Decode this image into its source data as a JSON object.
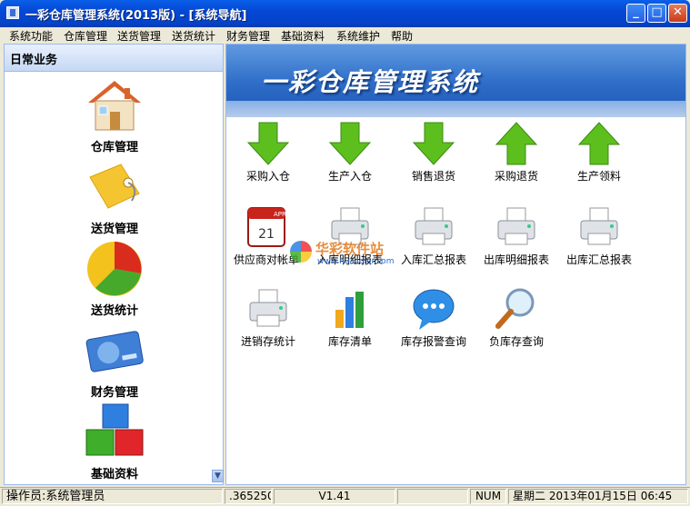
{
  "window": {
    "title": "一彩仓库管理系统(2013版) - [系统导航]"
  },
  "menu": [
    "系统功能",
    "仓库管理",
    "送货管理",
    "送货统计",
    "财务管理",
    "基础资料",
    "系统维护",
    "帮助"
  ],
  "left_panel": {
    "header": "日常业务",
    "items": [
      {
        "label": "仓库管理",
        "icon": "house-icon"
      },
      {
        "label": "送货管理",
        "icon": "tag-icon"
      },
      {
        "label": "送货统计",
        "icon": "pie-chart-icon"
      },
      {
        "label": "财务管理",
        "icon": "credit-card-icon"
      },
      {
        "label": "基础资料",
        "icon": "blocks-icon"
      }
    ]
  },
  "banner": {
    "title": "一彩仓库管理系统"
  },
  "tiles": [
    {
      "label": "采购入仓",
      "icon": "arrow-down-icon"
    },
    {
      "label": "生产入仓",
      "icon": "arrow-down-icon"
    },
    {
      "label": "销售退货",
      "icon": "arrow-down-icon"
    },
    {
      "label": "采购退货",
      "icon": "arrow-up-icon"
    },
    {
      "label": "生产领料",
      "icon": "arrow-up-icon"
    },
    {
      "label": "供应商对帐单",
      "icon": "calendar-icon",
      "calendar_month": "APR",
      "calendar_day": "21"
    },
    {
      "label": "入库明细报表",
      "icon": "printer-icon"
    },
    {
      "label": "入库汇总报表",
      "icon": "printer-icon"
    },
    {
      "label": "出库明细报表",
      "icon": "printer-icon"
    },
    {
      "label": "出库汇总报表",
      "icon": "printer-icon"
    },
    {
      "label": "进销存统计",
      "icon": "printer-icon"
    },
    {
      "label": "库存清单",
      "icon": "bar-chart-icon"
    },
    {
      "label": "库存报警查询",
      "icon": "speech-bubble-icon"
    },
    {
      "label": "负库存查询",
      "icon": "magnifier-icon"
    }
  ],
  "watermark": {
    "text": "华彩软件站",
    "url": "www.huacolor.com"
  },
  "status": {
    "operator": "操作员:系统管理员",
    "code": ".365250",
    "version": "V1.41",
    "num": "NUM",
    "datetime": "星期二 2013年01月15日 06:45"
  },
  "colors": {
    "titlebar": "#0548d6",
    "banner": "#2d6cc8",
    "arrow_green": "#5cbf1e",
    "panel_border": "#9db9eb"
  }
}
